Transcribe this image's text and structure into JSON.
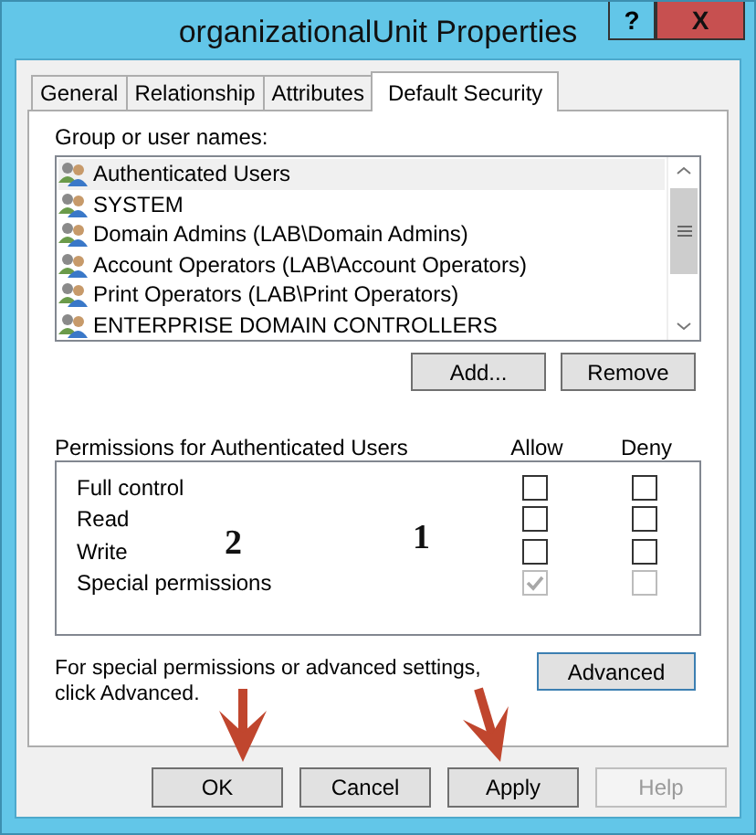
{
  "window": {
    "title": "organizationalUnit Properties",
    "help_button": "?",
    "close_button": "X"
  },
  "tabs": [
    {
      "label": "General",
      "selected": false
    },
    {
      "label": "Relationship",
      "selected": false
    },
    {
      "label": "Attributes",
      "selected": false
    },
    {
      "label": "Default Security",
      "selected": true
    }
  ],
  "group_label": "Group or user names:",
  "users": [
    {
      "name": "Authenticated Users",
      "selected": true
    },
    {
      "name": "SYSTEM",
      "selected": false
    },
    {
      "name": "Domain Admins (LAB\\Domain Admins)",
      "selected": false
    },
    {
      "name": "Account Operators (LAB\\Account Operators)",
      "selected": false
    },
    {
      "name": "Print Operators (LAB\\Print Operators)",
      "selected": false
    },
    {
      "name": "ENTERPRISE DOMAIN CONTROLLERS",
      "selected": false
    }
  ],
  "user_buttons": [
    "Add...",
    "Remove"
  ],
  "permissions": {
    "title": "Permissions for Authenticated Users",
    "allow_heading": "Allow",
    "deny_heading": "Deny",
    "rows": [
      {
        "name": "Full control",
        "allow": {
          "checked": false,
          "disabled": false
        },
        "deny": {
          "checked": false,
          "disabled": false
        }
      },
      {
        "name": "Read",
        "allow": {
          "checked": false,
          "disabled": false
        },
        "deny": {
          "checked": false,
          "disabled": false
        }
      },
      {
        "name": "Write",
        "allow": {
          "checked": false,
          "disabled": false
        },
        "deny": {
          "checked": false,
          "disabled": false
        }
      },
      {
        "name": "Special permissions",
        "allow": {
          "checked": true,
          "disabled": true
        },
        "deny": {
          "checked": false,
          "disabled": true
        }
      }
    ]
  },
  "advanced_note": "For special permissions or advanced settings, click Advanced.",
  "advanced_button": "Advanced",
  "buttons": [
    {
      "label": "OK",
      "disabled": false
    },
    {
      "label": "Cancel",
      "disabled": false
    },
    {
      "label": "Apply",
      "disabled": false
    },
    {
      "label": "Help",
      "disabled": true
    }
  ],
  "annotations": [
    {
      "number": "2"
    },
    {
      "number": "1"
    }
  ]
}
